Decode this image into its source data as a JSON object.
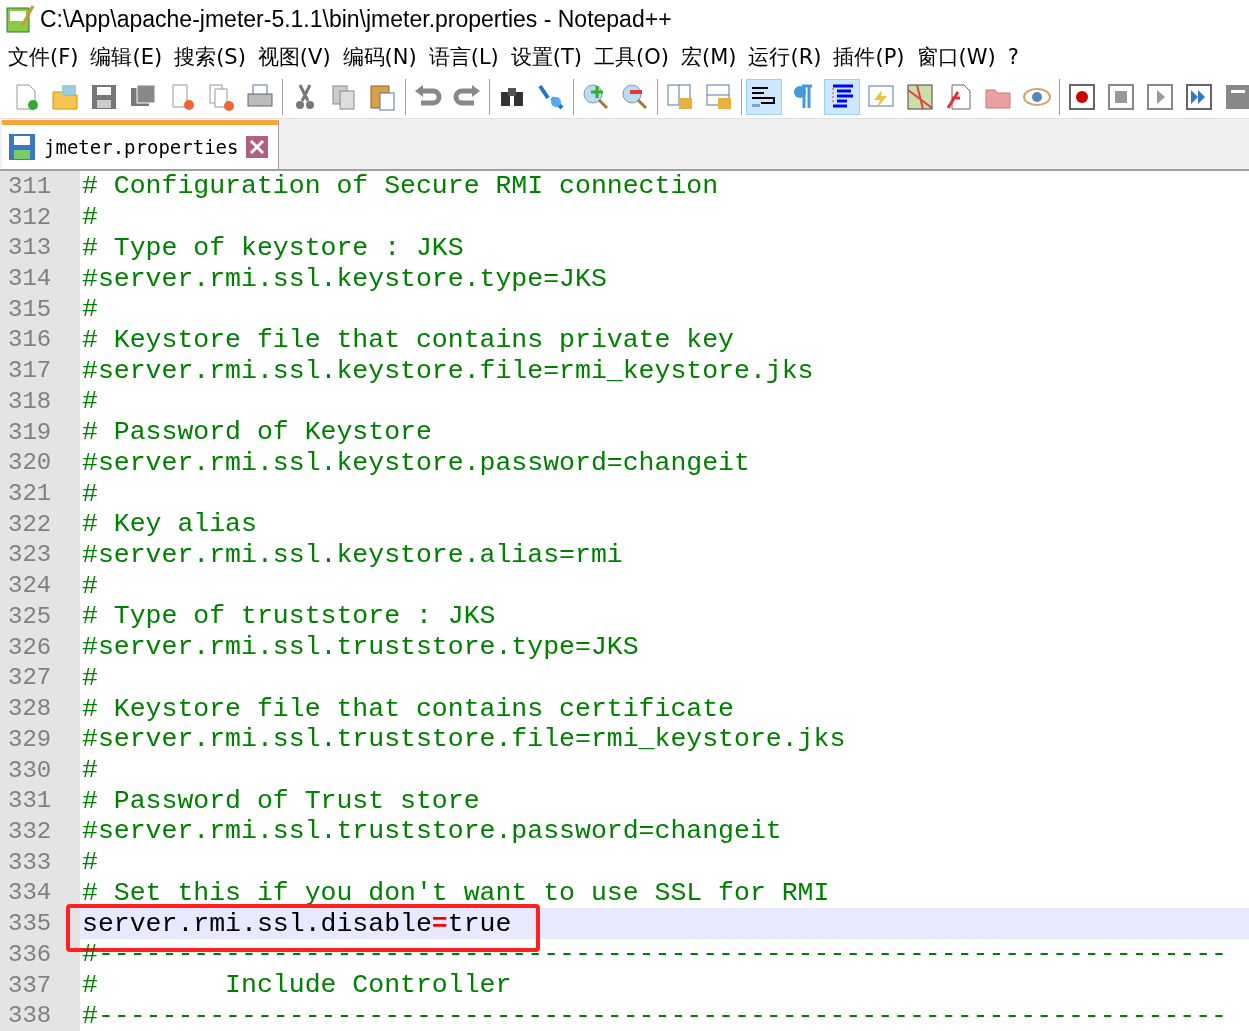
{
  "window": {
    "title": "C:\\App\\apache-jmeter-5.1.1\\bin\\jmeter.properties - Notepad++"
  },
  "menu": [
    "文件(F)",
    "编辑(E)",
    "搜索(S)",
    "视图(V)",
    "编码(N)",
    "语言(L)",
    "设置(T)",
    "工具(O)",
    "宏(M)",
    "运行(R)",
    "插件(P)",
    "窗口(W)",
    "?"
  ],
  "toolbar": {
    "groups": [
      [
        {
          "kind": "new",
          "pressed": false
        },
        {
          "kind": "open",
          "pressed": false
        },
        {
          "kind": "save",
          "pressed": false
        },
        {
          "kind": "saveall",
          "pressed": false
        },
        {
          "kind": "close",
          "pressed": false
        },
        {
          "kind": "closeall",
          "pressed": false
        },
        {
          "kind": "print",
          "pressed": false
        }
      ],
      [
        {
          "kind": "cut",
          "pressed": false
        },
        {
          "kind": "copy",
          "pressed": false
        },
        {
          "kind": "paste",
          "pressed": false
        }
      ],
      [
        {
          "kind": "undo",
          "pressed": false
        },
        {
          "kind": "redo",
          "pressed": false
        }
      ],
      [
        {
          "kind": "find",
          "pressed": false
        },
        {
          "kind": "replace",
          "pressed": false
        }
      ],
      [
        {
          "kind": "zoomin",
          "pressed": false
        },
        {
          "kind": "zoomout",
          "pressed": false
        }
      ],
      [
        {
          "kind": "syncv",
          "pressed": false
        },
        {
          "kind": "synch",
          "pressed": false
        }
      ],
      [
        {
          "kind": "wrap",
          "pressed": true
        },
        {
          "kind": "pilcrow",
          "pressed": false
        },
        {
          "kind": "indent",
          "pressed": true
        },
        {
          "kind": "lang",
          "pressed": false
        },
        {
          "kind": "map",
          "pressed": false
        },
        {
          "kind": "function",
          "pressed": false
        },
        {
          "kind": "folder",
          "pressed": false
        },
        {
          "kind": "eye",
          "pressed": false
        }
      ],
      [
        {
          "kind": "record",
          "pressed": false
        },
        {
          "kind": "stop",
          "pressed": false
        },
        {
          "kind": "play",
          "pressed": false
        },
        {
          "kind": "playmulti",
          "pressed": false
        },
        {
          "kind": "savemacro",
          "pressed": false
        }
      ]
    ]
  },
  "tabs": [
    {
      "label": "jmeter.properties",
      "selected": true
    }
  ],
  "editor": {
    "lines": [
      {
        "number": "311",
        "kind": "comment",
        "text": "# Configuration of Secure RMI connection",
        "current": false,
        "boxed": false
      },
      {
        "number": "312",
        "kind": "comment",
        "text": "#",
        "current": false,
        "boxed": false
      },
      {
        "number": "313",
        "kind": "comment",
        "text": "# Type of keystore : JKS",
        "current": false,
        "boxed": false
      },
      {
        "number": "314",
        "kind": "comment",
        "text": "#server.rmi.ssl.keystore.type=JKS",
        "current": false,
        "boxed": false
      },
      {
        "number": "315",
        "kind": "comment",
        "text": "#",
        "current": false,
        "boxed": false
      },
      {
        "number": "316",
        "kind": "comment",
        "text": "# Keystore file that contains private key",
        "current": false,
        "boxed": false
      },
      {
        "number": "317",
        "kind": "comment",
        "text": "#server.rmi.ssl.keystore.file=rmi_keystore.jks",
        "current": false,
        "boxed": false
      },
      {
        "number": "318",
        "kind": "comment",
        "text": "#",
        "current": false,
        "boxed": false
      },
      {
        "number": "319",
        "kind": "comment",
        "text": "# Password of Keystore",
        "current": false,
        "boxed": false
      },
      {
        "number": "320",
        "kind": "comment",
        "text": "#server.rmi.ssl.keystore.password=changeit",
        "current": false,
        "boxed": false
      },
      {
        "number": "321",
        "kind": "comment",
        "text": "#",
        "current": false,
        "boxed": false
      },
      {
        "number": "322",
        "kind": "comment",
        "text": "# Key alias",
        "current": false,
        "boxed": false
      },
      {
        "number": "323",
        "kind": "comment",
        "text": "#server.rmi.ssl.keystore.alias=rmi",
        "current": false,
        "boxed": false
      },
      {
        "number": "324",
        "kind": "comment",
        "text": "#",
        "current": false,
        "boxed": false
      },
      {
        "number": "325",
        "kind": "comment",
        "text": "# Type of truststore : JKS",
        "current": false,
        "boxed": false
      },
      {
        "number": "326",
        "kind": "comment",
        "text": "#server.rmi.ssl.truststore.type=JKS",
        "current": false,
        "boxed": false
      },
      {
        "number": "327",
        "kind": "comment",
        "text": "#",
        "current": false,
        "boxed": false
      },
      {
        "number": "328",
        "kind": "comment",
        "text": "# Keystore file that contains certificate",
        "current": false,
        "boxed": false
      },
      {
        "number": "329",
        "kind": "comment",
        "text": "#server.rmi.ssl.truststore.file=rmi_keystore.jks",
        "current": false,
        "boxed": false
      },
      {
        "number": "330",
        "kind": "comment",
        "text": "#",
        "current": false,
        "boxed": false
      },
      {
        "number": "331",
        "kind": "comment",
        "text": "# Password of Trust store",
        "current": false,
        "boxed": false
      },
      {
        "number": "332",
        "kind": "comment",
        "text": "#server.rmi.ssl.truststore.password=changeit",
        "current": false,
        "boxed": false
      },
      {
        "number": "333",
        "kind": "comment",
        "text": "#",
        "current": false,
        "boxed": false
      },
      {
        "number": "334",
        "kind": "comment",
        "text": "# Set this if you don't want to use SSL for RMI",
        "current": false,
        "boxed": false
      },
      {
        "number": "335",
        "kind": "property",
        "key": "server.rmi.ssl.disable",
        "operator": "=",
        "value": "true",
        "current": true,
        "boxed": true
      },
      {
        "number": "336",
        "kind": "comment",
        "text": "#-----------------------------------------------------------------------",
        "current": false,
        "boxed": false
      },
      {
        "number": "337",
        "kind": "comment",
        "text": "#        Include Controller",
        "current": false,
        "boxed": false
      },
      {
        "number": "338",
        "kind": "comment",
        "text": "#-----------------------------------------------------------------------",
        "current": false,
        "boxed": false
      }
    ]
  }
}
